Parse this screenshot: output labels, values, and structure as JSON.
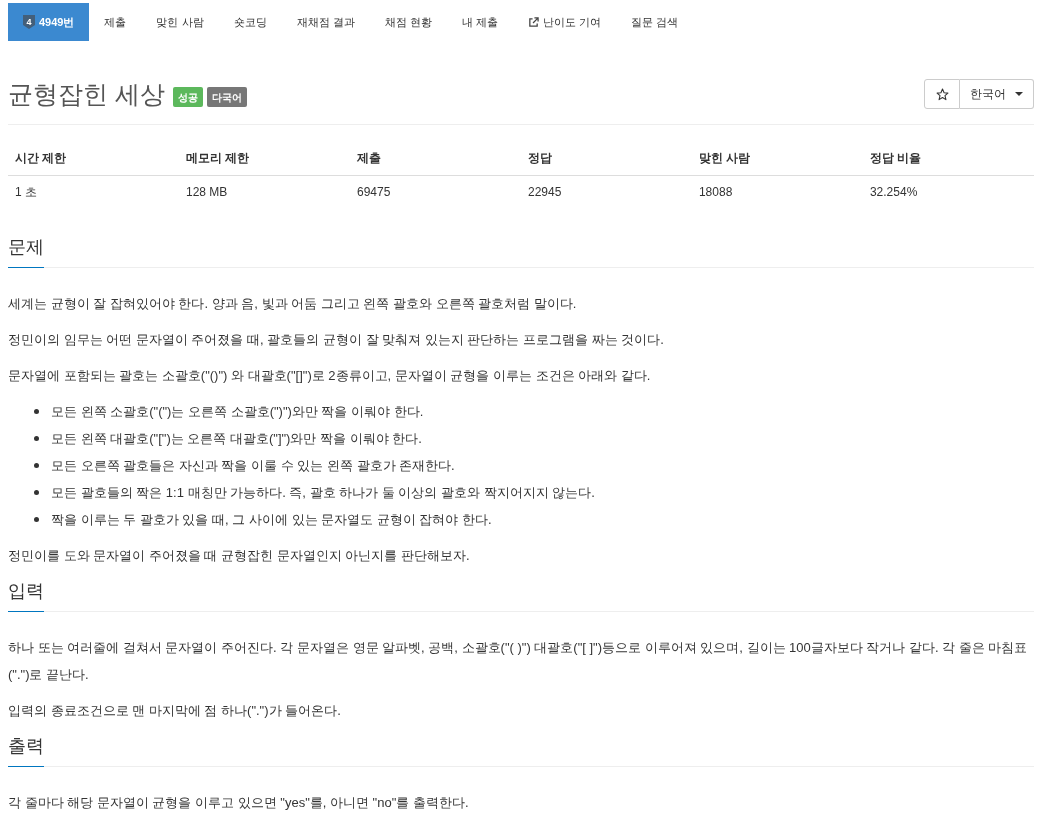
{
  "nav": {
    "items": [
      {
        "label": "4949번",
        "kind": "problem",
        "tier": "4",
        "selected": true
      },
      {
        "label": "제출",
        "kind": "link",
        "selected": false
      },
      {
        "label": "맞힌 사람",
        "kind": "link",
        "selected": false
      },
      {
        "label": "숏코딩",
        "kind": "link",
        "selected": false
      },
      {
        "label": "재채점 결과",
        "kind": "link",
        "selected": false
      },
      {
        "label": "채점 현황",
        "kind": "link",
        "selected": false
      },
      {
        "label": "내 제출",
        "kind": "link",
        "selected": false
      },
      {
        "label": "난이도 기여",
        "kind": "external",
        "selected": false
      },
      {
        "label": "질문 검색",
        "kind": "link",
        "selected": false
      }
    ]
  },
  "problem": {
    "title": "균형잡힌 세상",
    "labels": [
      {
        "text": "성공",
        "color": "#5cb85c"
      },
      {
        "text": "다국어",
        "color": "#777777"
      }
    ]
  },
  "toolbar": {
    "starred": false,
    "language": "한국어"
  },
  "info_table": {
    "columns": [
      "시간 제한",
      "메모리 제한",
      "제출",
      "정답",
      "맞힌 사람",
      "정답 비율"
    ],
    "rows": [
      [
        "1 초",
        "128 MB",
        "69475",
        "22945",
        "18088",
        "32.254%"
      ]
    ]
  },
  "sections": [
    {
      "heading": "문제",
      "blocks": [
        {
          "kind": "paragraph",
          "text": "세계는 균형이 잘 잡혀있어야 한다. 양과 음, 빛과 어둠 그리고 왼쪽 괄호와 오른쪽 괄호처럼 말이다."
        },
        {
          "kind": "paragraph",
          "text": "정민이의 임무는 어떤 문자열이 주어졌을 때, 괄호들의 균형이 잘 맞춰져 있는지 판단하는 프로그램을 짜는 것이다."
        },
        {
          "kind": "paragraph",
          "text": "문자열에 포함되는 괄호는 소괄호(\"()\") 와 대괄호(\"[]\")로 2종류이고, 문자열이 균형을 이루는 조건은 아래와 같다."
        },
        {
          "kind": "list",
          "items": [
            "모든 왼쪽 소괄호(\"(\")는 오른쪽 소괄호(\")\")와만 짝을 이뤄야 한다.",
            "모든 왼쪽 대괄호(\"[\")는 오른쪽 대괄호(\"]\")와만 짝을 이뤄야 한다.",
            "모든 오른쪽 괄호들은 자신과 짝을 이룰 수 있는 왼쪽 괄호가 존재한다.",
            "모든 괄호들의 짝은 1:1 매칭만 가능하다. 즉, 괄호 하나가 둘 이상의 괄호와 짝지어지지 않는다.",
            "짝을 이루는 두 괄호가 있을 때, 그 사이에 있는 문자열도 균형이 잡혀야 한다."
          ]
        },
        {
          "kind": "paragraph",
          "text": "정민이를 도와 문자열이 주어졌을 때 균형잡힌 문자열인지 아닌지를 판단해보자."
        }
      ]
    },
    {
      "heading": "입력",
      "blocks": [
        {
          "kind": "paragraph",
          "text": "하나 또는 여러줄에 걸쳐서 문자열이 주어진다. 각 문자열은 영문 알파벳, 공백, 소괄호(\"( )\") 대괄호(\"[ ]\")등으로 이루어져 있으며, 길이는 100글자보다 작거나 같다. 각 줄은 마침표(\".\")로 끝난다."
        },
        {
          "kind": "paragraph",
          "text": "입력의 종료조건으로 맨 마지막에 점 하나(\".\")가 들어온다."
        }
      ]
    },
    {
      "heading": "출력",
      "blocks": [
        {
          "kind": "paragraph",
          "text": "각 줄마다 해당 문자열이 균형을 이루고 있으면 \"yes\"를, 아니면 \"no\"를 출력한다."
        }
      ]
    }
  ]
}
